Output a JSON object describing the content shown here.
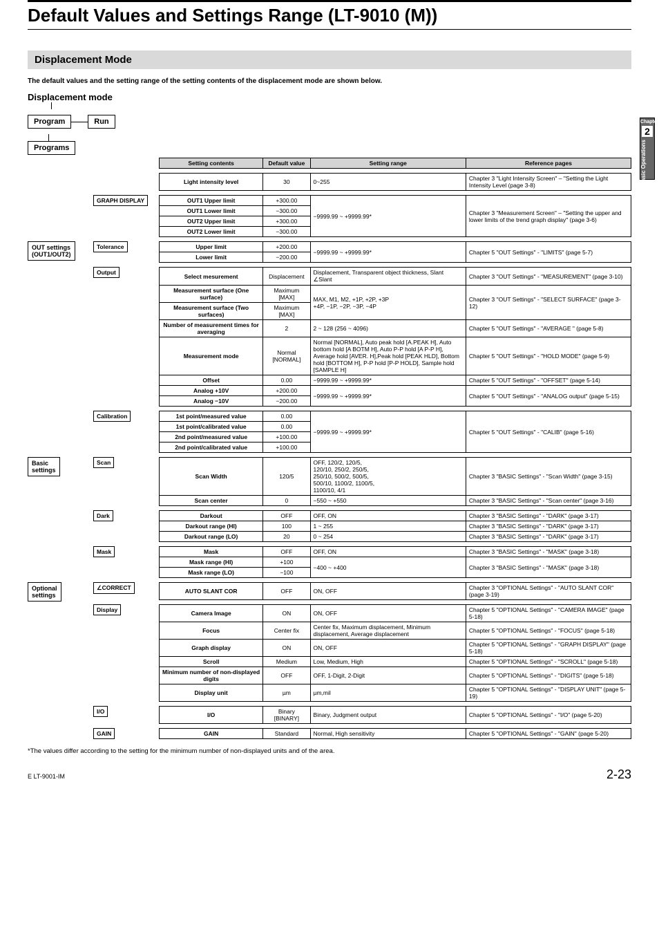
{
  "page_title": "Default Values and Settings Range (LT-9010 (M))",
  "section": "Displacement Mode",
  "subtitle": "The default values and the setting range of the setting contents of the displacement mode are shown below.",
  "mode_title": "Displacement mode",
  "sidetab": {
    "chapter_label": "Chapter",
    "num": "2",
    "text": "Basic Operations"
  },
  "top_nodes": {
    "program": "Program",
    "run": "Run",
    "programs": "Programs"
  },
  "headers": {
    "c1": "Setting contents",
    "c2": "Default value",
    "c3": "Setting range",
    "c4": "Reference pages"
  },
  "groups": [
    {
      "l1": null,
      "l2": null,
      "rows": [
        {
          "c1": "Light intensity level",
          "c2": "30",
          "c3": "0~255",
          "c4": "Chapter 3 \"Light Intensity Screen\" – \"Setting the Light Intensity Level (page 3-8)"
        }
      ]
    },
    {
      "l1": null,
      "l2": "GRAPH DISPLAY",
      "rows": [
        {
          "c1": "OUT1 Upper limit",
          "c2": "+300.00",
          "c3span": true
        },
        {
          "c1": "OUT1 Lower limit",
          "c2": "−300.00"
        },
        {
          "c1": "OUT2 Upper limit",
          "c2": "+300.00"
        },
        {
          "c1": "OUT2 Lower limit",
          "c2": "−300.00"
        }
      ],
      "merged_c3": "−9999.99 ~ +9999.99*",
      "merged_c4": "Chapter 3 \"Measurement Screen\" – \"Setting the upper and lower limits of the trend graph display\" (page 3-6)"
    },
    {
      "l1": "OUT settings\n(OUT1/OUT2)",
      "l2": "Tolerance",
      "rows": [
        {
          "c1": "Upper limit",
          "c2": "+200.00"
        },
        {
          "c1": "Lower limit",
          "c2": "−200.00"
        }
      ],
      "merged_c3": "−9999.99 ~ +9999.99*",
      "merged_c4": "Chapter 5 \"OUT Settings\" - \"LIMITS\" (page 5-7)"
    },
    {
      "l2": "Output",
      "rows": [
        {
          "c1": "Select mesurement",
          "c2": "Displacement",
          "c3": "Displacement, Transparent object thickness, Slant ∠Slant",
          "c4": "Chapter 3 \"OUT Settings\" - \"MEASUREMENT\" (page 3-10)"
        },
        {
          "c1": "Measurement surface (One surface)",
          "c2": "Maximum [MAX]",
          "c3row2": true,
          "c4row2": true
        },
        {
          "c1": "Measurement surface (Two surfaces)",
          "c2": "Maximum [MAX]",
          "mc3": "MAX, M1, M2, +1P, +2P, +3P\n+4P, −1P, −2P, −3P, −4P",
          "mc4": "Chapter 3 \"OUT Settings\" - \"SELECT SURFACE\" (page 3-12)"
        },
        {
          "c1": "Number of measurement times for averaging",
          "c2": "2",
          "c3": "2 ~ 128 (256 ~ 4096)",
          "c4": "Chapter 5 \"OUT Settings\" - \"AVERAGE \" (page 5-8)"
        },
        {
          "c1": "Measurement mode",
          "c2": "Normal [NORMAL]",
          "c3": "Normal [NORMAL], Auto peak hold [A.PEAK H], Auto bottom hold [A BOTM H], Auto P-P hold [A P-P H], Average hold [AVER. H],Peak hold [PEAK HLD], Bottom hold [BOTTOM H], P-P hold [P-P HOLD], Sample hold [SAMPLE H]",
          "c4": "Chapter 5 \"OUT Settings\" - \"HOLD MODE\" (page 5-9)"
        },
        {
          "c1": "Offset",
          "c2": "0.00",
          "c3": "−9999.99 ~ +9999.99*",
          "c4": "Chapter 5 \"OUT Settings\" - \"OFFSET\" (page 5-14)"
        },
        {
          "c1": "Analog +10V",
          "c2": "+200.00",
          "pair_c3": "−9999.99 ~ +9999.99*",
          "pair_c4": "Chapter 5 \"OUT Settings\" - \"ANALOG output\" (page 5-15)"
        },
        {
          "c1": "Analog −10V",
          "c2": "−200.00"
        }
      ]
    },
    {
      "l2": "Calibration",
      "rows": [
        {
          "c1": "1st point/measured value",
          "c2": "0.00"
        },
        {
          "c1": "1st point/calibrated value",
          "c2": "0.00"
        },
        {
          "c1": "2nd point/measured value",
          "c2": "+100.00"
        },
        {
          "c1": "2nd point/calibrated value",
          "c2": "+100.00"
        }
      ],
      "merged_c3": "−9999.99 ~ +9999.99*",
      "merged_c4": "Chapter 5 \"OUT Settings\" - \"CALIB\" (page 5-16)"
    },
    {
      "l1": "Basic\nsettings",
      "l2": "Scan",
      "rows": [
        {
          "c1": "Scan Width",
          "c2": "120/5",
          "c3": "OFF, 120/2, 120/5,\n120/10, 250/2, 250/5,\n250/10, 500/2, 500/5,\n500/10, 1100/2, 1100/5,\n1100/10, 4/1",
          "c4": "Chapter 3 \"BASIC Settings\" - \"Scan Width\" (page 3-15)"
        },
        {
          "c1": "Scan center",
          "c2": "0",
          "c3": "−550 ~ +550",
          "c4": "Chapter 3 \"BASIC Settings\" - \"Scan center\" (page 3-16)"
        }
      ]
    },
    {
      "l2": "Dark",
      "rows": [
        {
          "c1": "Darkout",
          "c2": "OFF",
          "c3": "OFF, ON",
          "c4": "Chapter 3 \"BASIC Settings\" - \"DARK\" (page 3-17)"
        },
        {
          "c1": "Darkout range (HI)",
          "c2": "100",
          "c3": "1 ~ 255",
          "c4": "Chapter 3 \"BASIC Settings\" - \"DARK\" (page 3-17)"
        },
        {
          "c1": "Darkout range (LO)",
          "c2": "20",
          "c3": "0 ~ 254",
          "c4": "Chapter 3 \"BASIC Settings\" - \"DARK\" (page 3-17)"
        }
      ]
    },
    {
      "l2": "Mask",
      "rows": [
        {
          "c1": "Mask",
          "c2": "OFF",
          "c3": "OFF, ON",
          "c4": "Chapter 3 \"BASIC Settings\" - \"MASK\" (page 3-18)"
        },
        {
          "c1": "Mask range (HI)",
          "c2": "+100",
          "pair_c3": "−400 ~ +400",
          "pair_c4": "Chapter 3 \"BASIC Settings\" - \"MASK\" (page 3-18)"
        },
        {
          "c1": "Mask range (LO)",
          "c2": "−100"
        }
      ]
    },
    {
      "l1": "Optional\nsettings",
      "l2": "∠CORRECT",
      "rows": [
        {
          "c1": "AUTO SLANT COR",
          "c2": "OFF",
          "c3": "ON, OFF",
          "c4": "Chapter 3 \"OPTIONAL Settings\" - \"AUTO SLANT COR\" (page 3-19)"
        }
      ]
    },
    {
      "l2": "Display",
      "rows": [
        {
          "c1": "Camera Image",
          "c2": "ON",
          "c3": "ON, OFF",
          "c4": "Chapter 5 \"OPTIONAL Settings\" - \"CAMERA IMAGE\" (page 5-18)"
        },
        {
          "c1": "Focus",
          "c2": "Center fix",
          "c3": "Center fix, Maximum displacement, Minimum displacement, Average displacement",
          "c4": "Chapter 5 \"OPTIONAL Settings\" - \"FOCUS\" (page 5-18)"
        },
        {
          "c1": "Graph display",
          "c2": "ON",
          "c3": "ON, OFF",
          "c4": "Chapter 5 \"OPTIONAL Settings\" - \"GRAPH DISPLAY\" (page 5-18)"
        },
        {
          "c1": "Scroll",
          "c2": "Medium",
          "c3": "Low, Medium, High",
          "c4": "Chapter 5 \"OPTIONAL Settings\" - \"SCROLL\" (page 5-18)"
        },
        {
          "c1": "Minimum number of non-displayed digits",
          "c2": "OFF",
          "c3": "OFF, 1-Digit, 2-Digit",
          "c4": "Chapter 5 \"OPTIONAL Settings\" - \"DIGITS\" (page 5-18)"
        },
        {
          "c1": "Display unit",
          "c2": "µm",
          "c3": "µm,mil",
          "c4": "Chapter 5 \"OPTIONAL Settings\" - \"DISPLAY UNIT\" (page 5-19)"
        }
      ]
    },
    {
      "l2": "I/O",
      "rows": [
        {
          "c1": "I/O",
          "c2": "Binary [BINARY]",
          "c3": "Binary, Judgment output",
          "c4": "Chapter 5 \"OPTIONAL Settings\" - \"I/O\" (page 5-20)"
        }
      ]
    },
    {
      "l2": "GAIN",
      "rows": [
        {
          "c1": "GAIN",
          "c2": "Standard",
          "c3": "Normal, High sensitivity",
          "c4": "Chapter 5 \"OPTIONAL Settings\" - \"GAIN\" (page 5-20)"
        }
      ]
    }
  ],
  "footnote": "*The values differ according to the setting for the minimum number of non-displayed units and of the area.",
  "footer_left": "E LT-9001-IM",
  "footer_right": "2-23"
}
